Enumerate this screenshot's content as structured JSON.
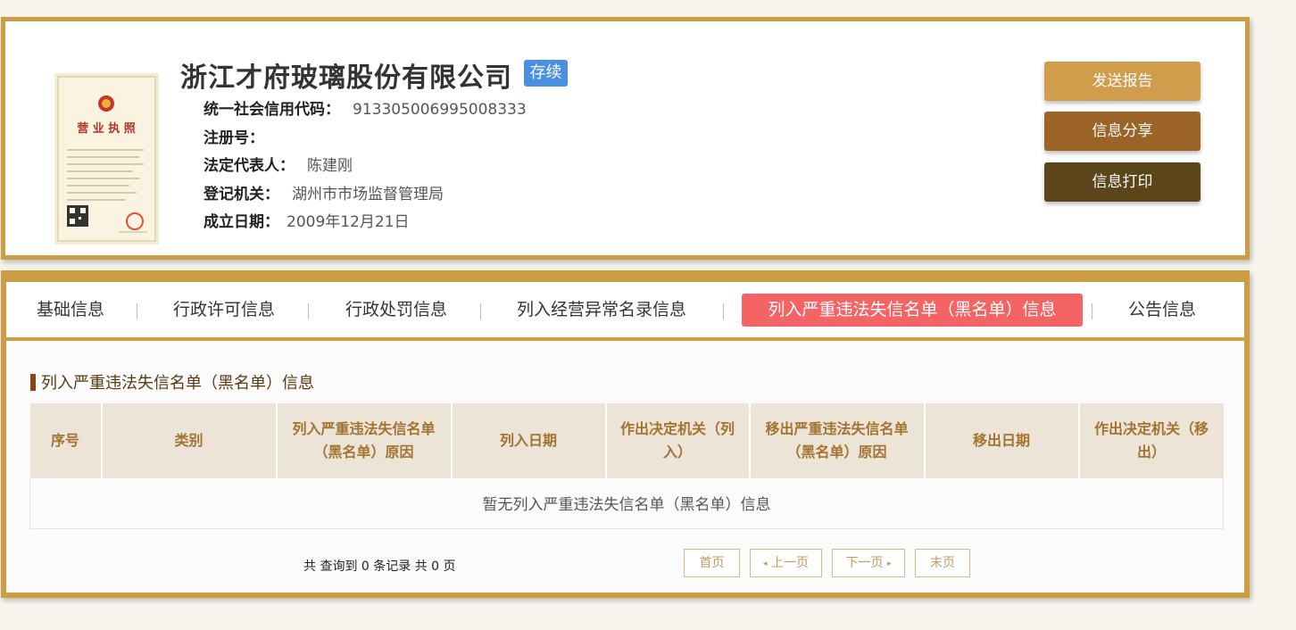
{
  "company": {
    "name": "浙江才府玻璃股份有限公司",
    "status": "存续",
    "license_image": {
      "title": "营业执照"
    },
    "fields": [
      {
        "label": "统一社会信用代码：",
        "value": "913305006995008333"
      },
      {
        "label": "注册号：",
        "value": ""
      },
      {
        "label": "法定代表人：",
        "value": "陈建刚"
      },
      {
        "label": "登记机关：",
        "value": "湖州市市场监督管理局"
      },
      {
        "label": "成立日期：",
        "value": "2009年12月21日"
      }
    ]
  },
  "actions": {
    "send_report": "发送报告",
    "share": "信息分享",
    "print": "信息打印"
  },
  "tabs": [
    {
      "label": "基础信息",
      "active": false
    },
    {
      "label": "行政许可信息",
      "active": false
    },
    {
      "label": "行政处罚信息",
      "active": false
    },
    {
      "label": "列入经营异常名录信息",
      "active": false
    },
    {
      "label": "列入严重违法失信名单（黑名单）信息",
      "active": true
    },
    {
      "label": "公告信息",
      "active": false
    }
  ],
  "section": {
    "title": "列入严重违法失信名单（黑名单）信息",
    "columns": [
      "序号",
      "类别",
      "列入严重违法失信名单（黑名单）原因",
      "列入日期",
      "作出决定机关（列入）",
      "移出严重违法失信名单（黑名单）原因",
      "移出日期",
      "作出决定机关（移出）"
    ],
    "empty_text": "暂无列入严重违法失信名单（黑名单）信息"
  },
  "pagination": {
    "summary": "共 查询到 0 条记录 共 0 页",
    "first": "首页",
    "prev": "上一页",
    "next": "下一页",
    "last": "末页"
  },
  "colors": {
    "frame": "#cc9d43",
    "status_badge": "#4a90e2",
    "active_tab": "#f46464",
    "btn_report": "#cf9d4b",
    "btn_share": "#9b6426",
    "btn_print": "#5c4519"
  }
}
